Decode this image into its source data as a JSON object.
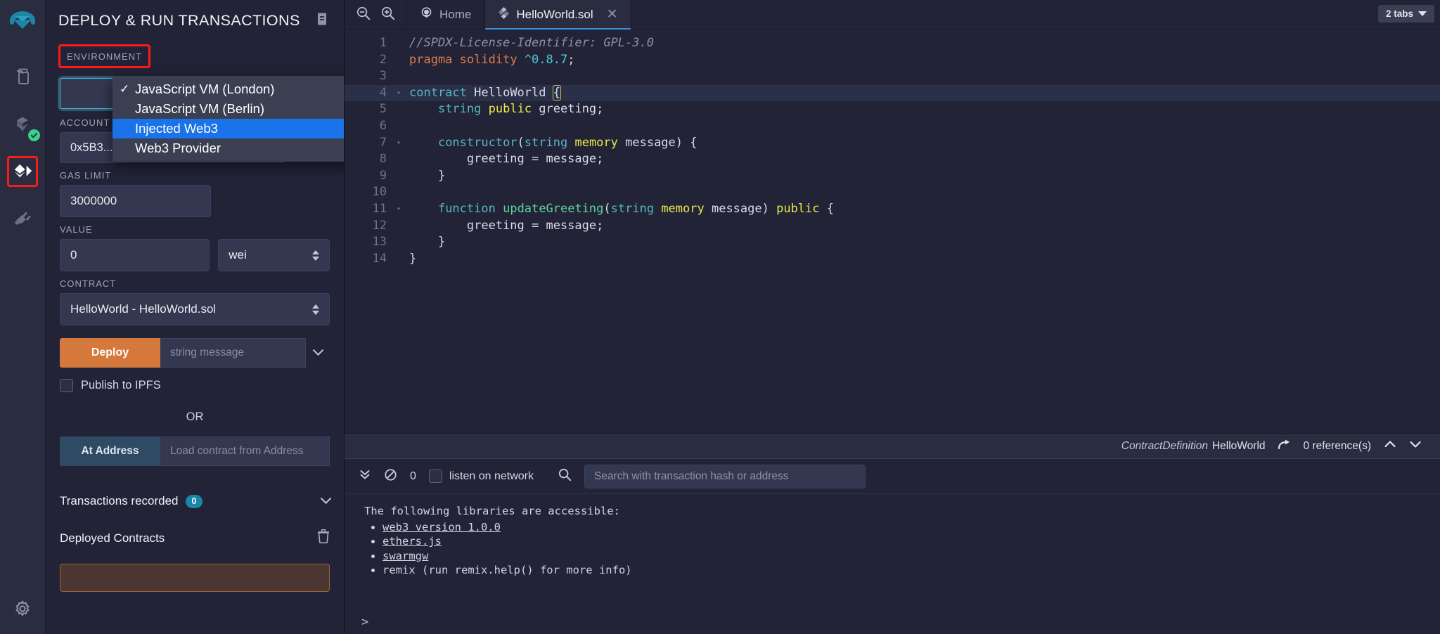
{
  "iconbar": {
    "logo_name": "remix-logo",
    "items": [
      {
        "name": "file-explorer-icon",
        "title": "File explorers"
      },
      {
        "name": "solidity-compiler-icon",
        "title": "Solidity compiler"
      },
      {
        "name": "deploy-run-icon",
        "title": "Deploy & run transactions"
      },
      {
        "name": "plugin-manager-icon",
        "title": "Plugin manager"
      }
    ],
    "settings": {
      "name": "settings-gear-icon",
      "title": "Settings"
    }
  },
  "panel": {
    "title": "DEPLOY & RUN TRANSACTIONS",
    "doc_icon": "document-icon",
    "environment": {
      "label": "ENVIRONMENT",
      "info_icon": "info-icon",
      "options": [
        {
          "label": "JavaScript VM (London)",
          "checked": true,
          "selected": false
        },
        {
          "label": "JavaScript VM (Berlin)",
          "checked": false,
          "selected": false
        },
        {
          "label": "Injected Web3",
          "checked": false,
          "selected": true
        },
        {
          "label": "Web3 Provider",
          "checked": false,
          "selected": false
        }
      ],
      "check_glyph": "✓"
    },
    "account": {
      "label": "ACCOUNT",
      "value": "0x5B3...eddC4 (100 ether)",
      "copy_icon": "copy-icon",
      "edit_icon": "edit-icon"
    },
    "gas_limit": {
      "label": "GAS LIMIT",
      "value": "3000000"
    },
    "value": {
      "label": "VALUE",
      "value": "0",
      "unit": "wei"
    },
    "contract": {
      "label": "CONTRACT",
      "value": "HelloWorld - HelloWorld.sol"
    },
    "deploy": {
      "button_label": "Deploy",
      "arg_placeholder": "string message",
      "expand_icon": "chevron-down-icon"
    },
    "publish_ipfs": {
      "label": "Publish to IPFS",
      "checked": false
    },
    "or_label": "OR",
    "at_address": {
      "button_label": "At Address",
      "input_placeholder": "Load contract from Address"
    },
    "transactions_recorded": {
      "label": "Transactions recorded",
      "count": "0"
    },
    "deployed_contracts": {
      "label": "Deployed Contracts",
      "trash_icon": "trash-icon"
    }
  },
  "tabbar": {
    "zoom_out_icon": "zoom-out-icon",
    "zoom_in_icon": "zoom-in-icon",
    "tabs": [
      {
        "label": "Home",
        "icon": "remix-home-icon",
        "active": false,
        "closable": false
      },
      {
        "label": "HelloWorld.sol",
        "icon": "solidity-file-icon",
        "active": true,
        "closable": true
      }
    ],
    "tabs_badge": "2 tabs",
    "close_glyph": "✕"
  },
  "editor": {
    "lines": [
      {
        "n": "1",
        "fold": "",
        "current": false,
        "tokens": [
          {
            "t": "//SPDX-License-Identifier: GPL-3.0",
            "c": "cm"
          }
        ]
      },
      {
        "n": "2",
        "fold": "",
        "current": false,
        "tokens": [
          {
            "t": "pragma",
            "c": "kw"
          },
          {
            "t": " ",
            "c": "wht"
          },
          {
            "t": "solidity",
            "c": "kw"
          },
          {
            "t": " ",
            "c": "wht"
          },
          {
            "t": "^0.8.7",
            "c": "num"
          },
          {
            "t": ";",
            "c": "wht"
          }
        ]
      },
      {
        "n": "3",
        "fold": "",
        "current": false,
        "tokens": []
      },
      {
        "n": "4",
        "fold": "▾",
        "current": true,
        "tokens": [
          {
            "t": "contract",
            "c": "kw2"
          },
          {
            "t": " ",
            "c": "wht"
          },
          {
            "t": "HelloWorld",
            "c": "wht"
          },
          {
            "t": " ",
            "c": "wht"
          },
          {
            "t": "{",
            "c": "brace"
          }
        ]
      },
      {
        "n": "5",
        "fold": "",
        "current": false,
        "tokens": [
          {
            "t": "    ",
            "c": "wht"
          },
          {
            "t": "string",
            "c": "kw2"
          },
          {
            "t": " ",
            "c": "wht"
          },
          {
            "t": "public",
            "c": "yel"
          },
          {
            "t": " greeting;",
            "c": "wht"
          }
        ]
      },
      {
        "n": "6",
        "fold": "",
        "current": false,
        "tokens": []
      },
      {
        "n": "7",
        "fold": "▾",
        "current": false,
        "tokens": [
          {
            "t": "    ",
            "c": "wht"
          },
          {
            "t": "constructor",
            "c": "kw2"
          },
          {
            "t": "(",
            "c": "wht"
          },
          {
            "t": "string",
            "c": "kw2"
          },
          {
            "t": " ",
            "c": "wht"
          },
          {
            "t": "memory",
            "c": "yel"
          },
          {
            "t": " message) {",
            "c": "wht"
          }
        ]
      },
      {
        "n": "8",
        "fold": "",
        "current": false,
        "tokens": [
          {
            "t": "        greeting = message;",
            "c": "wht"
          }
        ]
      },
      {
        "n": "9",
        "fold": "",
        "current": false,
        "tokens": [
          {
            "t": "    }",
            "c": "wht"
          }
        ]
      },
      {
        "n": "10",
        "fold": "",
        "current": false,
        "tokens": []
      },
      {
        "n": "11",
        "fold": "▾",
        "current": false,
        "tokens": [
          {
            "t": "    ",
            "c": "wht"
          },
          {
            "t": "function",
            "c": "kw2"
          },
          {
            "t": " ",
            "c": "wht"
          },
          {
            "t": "updateGreeting",
            "c": "grn"
          },
          {
            "t": "(",
            "c": "wht"
          },
          {
            "t": "string",
            "c": "kw2"
          },
          {
            "t": " ",
            "c": "wht"
          },
          {
            "t": "memory",
            "c": "yel"
          },
          {
            "t": " message) ",
            "c": "wht"
          },
          {
            "t": "public",
            "c": "yel"
          },
          {
            "t": " {",
            "c": "wht"
          }
        ]
      },
      {
        "n": "12",
        "fold": "",
        "current": false,
        "tokens": [
          {
            "t": "        greeting = message;",
            "c": "wht"
          }
        ]
      },
      {
        "n": "13",
        "fold": "",
        "current": false,
        "tokens": [
          {
            "t": "    }",
            "c": "wht"
          }
        ]
      },
      {
        "n": "14",
        "fold": "",
        "current": false,
        "tokens": [
          {
            "t": "}",
            "c": "wht"
          }
        ]
      }
    ]
  },
  "statusbar": {
    "definition_kind": "ContractDefinition",
    "definition_name": "HelloWorld",
    "goto_icon": "goto-reference-icon",
    "references": "0 reference(s)",
    "up_icon": "chevron-up-icon",
    "down_icon": "chevron-down-icon"
  },
  "terminal": {
    "collapse_icon": "double-chevron-down-icon",
    "clear_icon": "ban-circle-icon",
    "count": "0",
    "listen_label": "listen on network",
    "listen_checked": false,
    "search_icon": "search-icon",
    "search_placeholder": "Search with transaction hash or address",
    "intro": "The following libraries are accessible:",
    "libraries": [
      {
        "text": "web3 version 1.0.0",
        "link": true
      },
      {
        "text": "ethers.js",
        "link": true
      },
      {
        "text": "swarmgw",
        "link": true
      },
      {
        "text": "remix (run remix.help() for more info)",
        "link": false
      }
    ],
    "prompt": ">"
  },
  "colors": {
    "accent_orange": "#d4783c",
    "accent_blue": "#1a73e8",
    "highlight_red": "#ff1a1a",
    "badge_teal": "#1a86a8",
    "ok_green": "#3ecf8e"
  }
}
